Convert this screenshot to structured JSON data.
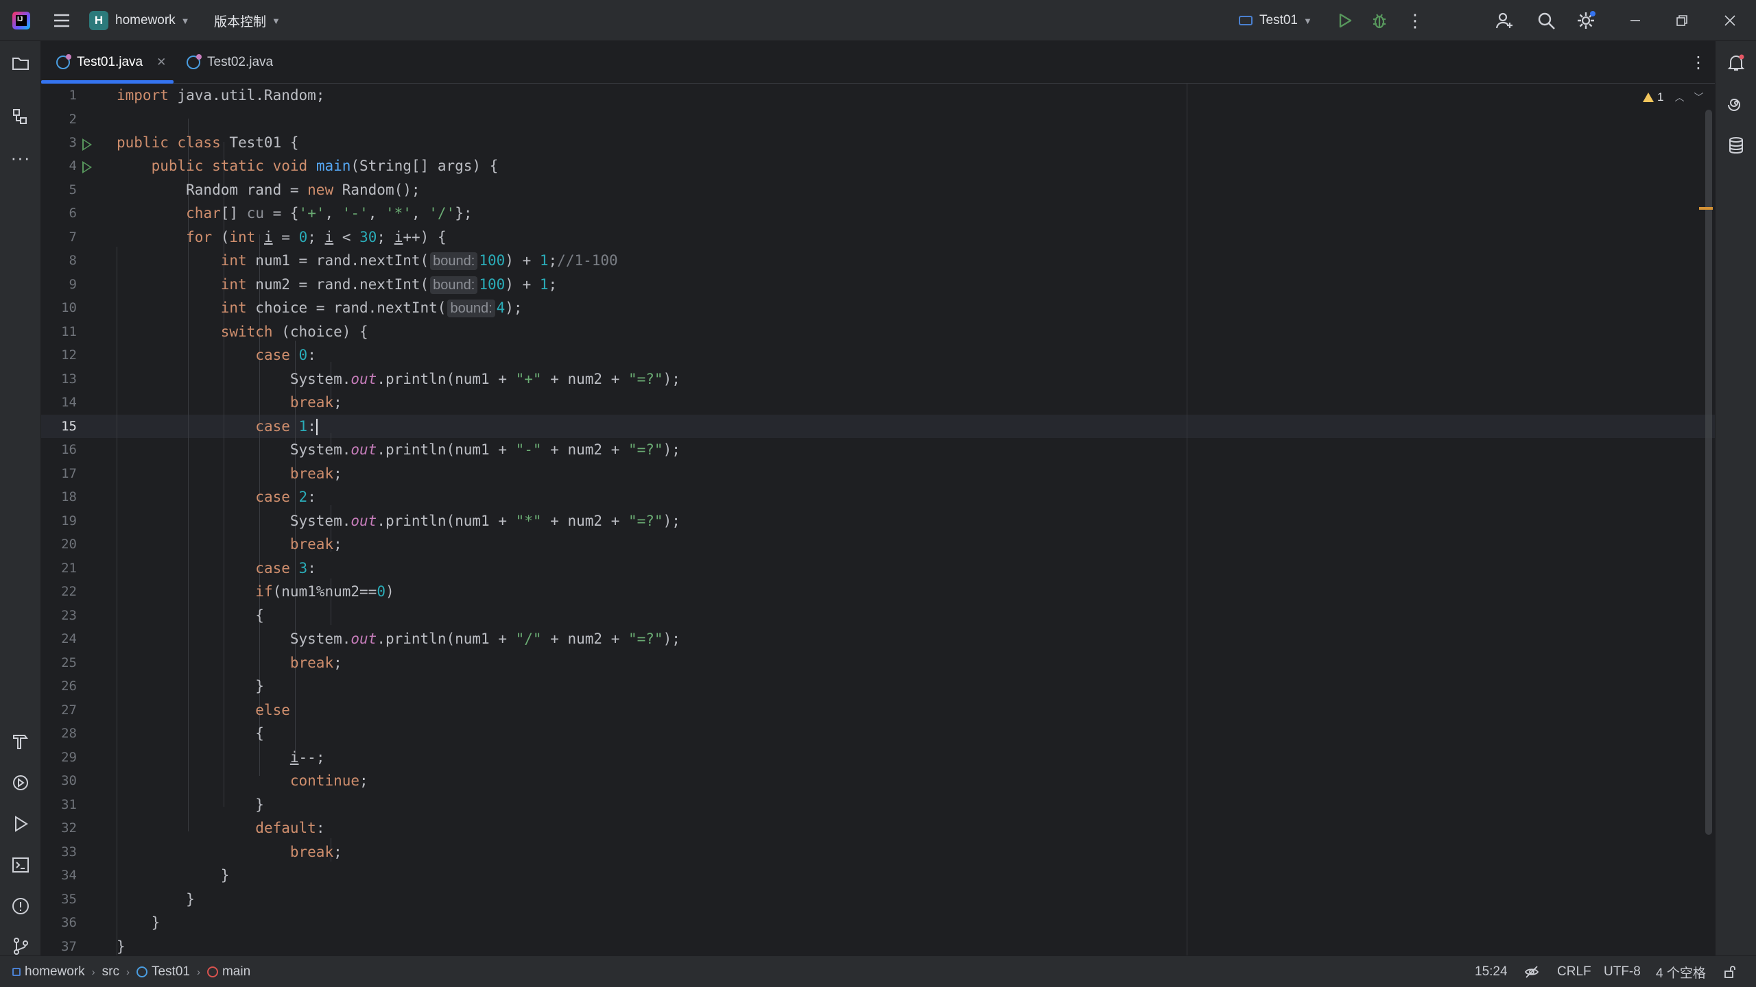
{
  "titlebar": {
    "project_badge": "H",
    "project_name": "homework",
    "vcs_label": "版本控制",
    "run_config": "Test01"
  },
  "tabs": [
    {
      "label": "Test01.java",
      "active": true
    },
    {
      "label": "Test02.java",
      "active": false
    }
  ],
  "editor": {
    "warning_count": "1",
    "line_numbers": [
      "1",
      "2",
      "3",
      "4",
      "5",
      "6",
      "7",
      "8",
      "9",
      "10",
      "11",
      "12",
      "13",
      "14",
      "15",
      "16",
      "17",
      "18",
      "19",
      "20",
      "21",
      "22",
      "23",
      "24",
      "25",
      "26",
      "27",
      "28",
      "29",
      "30",
      "31",
      "32",
      "33",
      "34",
      "35",
      "36",
      "37"
    ],
    "current_line": 15
  },
  "statusbar": {
    "breadcrumb": [
      "homework",
      "src",
      "Test01",
      "main"
    ],
    "caret_position": "15:24",
    "line_separator": "CRLF",
    "encoding": "UTF-8",
    "indent": "4 个空格"
  },
  "colors": {
    "accent": "#3574f0",
    "keyword": "#cf8e6d",
    "number": "#2aacb8",
    "string": "#6aab73",
    "function": "#56a8f5",
    "static_field": "#c77dbb",
    "warning": "#f2c55c",
    "run": "#57965c"
  }
}
